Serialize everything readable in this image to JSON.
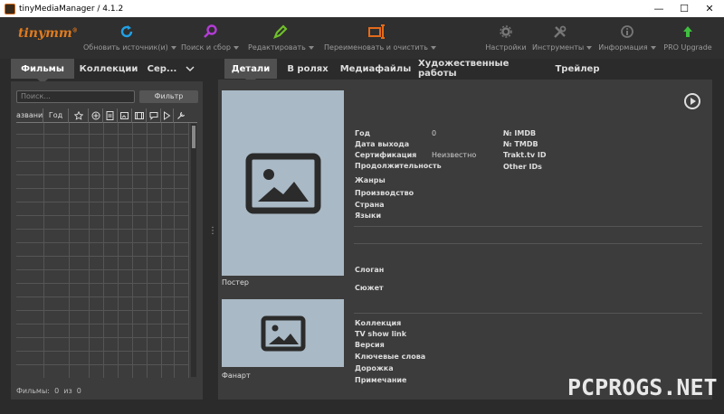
{
  "window": {
    "title": "tinyMediaManager / 4.1.2"
  },
  "toolbar": {
    "logo": "tinymm",
    "logo_mark": "®",
    "update_sources": "Обновить источник(и)",
    "search_scrape": "Поиск и сбор",
    "edit": "Редактировать",
    "rename_clean": "Переименовать и очистить",
    "settings": "Настройки",
    "tools": "Инструменты",
    "info": "Информация",
    "pro_upgrade": "PRO Upgrade",
    "colors": {
      "update": "#21a1e6",
      "search": "#b43cd6",
      "edit": "#6fbf2a",
      "rename": "#e36b1a",
      "pro": "#3fbf3f"
    }
  },
  "left": {
    "tabs": [
      "Фильмы",
      "Коллекции",
      "Сер..."
    ],
    "search_placeholder": "Поиск...",
    "filter_label": "Фильтр",
    "columns": {
      "title": "азвание",
      "year": "Год"
    },
    "status": {
      "label": "Фильмы:",
      "shown": "0",
      "of": "из",
      "total": "0"
    }
  },
  "right": {
    "tabs": [
      "Детали",
      "В ролях",
      "Медиафайлы",
      "Художественные работы",
      "Трейлер"
    ],
    "poster_caption": "Постер",
    "fanart_caption": "Фанарт",
    "fields": {
      "year": "Год",
      "year_value": "0",
      "release": "Дата выхода",
      "cert": "Сертификация",
      "cert_value": "Неизвестно",
      "runtime": "Продолжительность",
      "genres": "Жанры",
      "production": "Производство",
      "country": "Страна",
      "languages": "Языки",
      "tagline": "Слоган",
      "plot": "Сюжет",
      "collection": "Коллекция",
      "tvshow": "TV show link",
      "version": "Версия",
      "keywords": "Ключевые слова",
      "track": "Дорожка",
      "note": "Примечание",
      "imdb": "№ IMDB",
      "tmdb": "№ TMDB",
      "trakt": "Trakt.tv ID",
      "other": "Other IDs"
    }
  },
  "watermark": "PCPROGS.NET"
}
